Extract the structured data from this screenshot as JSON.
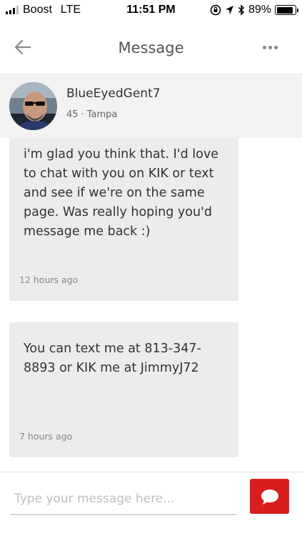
{
  "status_bar": {
    "carrier": "Boost",
    "network": "LTE",
    "time": "11:51 PM",
    "battery_percent": "89%",
    "battery_level": 0.89
  },
  "nav": {
    "title": "Message",
    "back_icon": "arrow-left-icon",
    "more_icon": "more-horizontal-icon"
  },
  "profile": {
    "username": "BlueEyedGent7",
    "age": "45",
    "separator": "·",
    "location": "Tampa"
  },
  "messages": [
    {
      "text": "i'm glad you think that. I'd love to chat with you on KIK or text and see if we're on the same page. Was really hoping you'd message me back :)",
      "time": "12 hours ago"
    },
    {
      "text": "You can text me at 813-347-8893 or KIK me at JimmyJ72",
      "time": "7 hours ago"
    }
  ],
  "composer": {
    "placeholder": "Type your message here...",
    "send_icon": "chat-bubble-icon"
  },
  "colors": {
    "accent": "#d81e1e",
    "bubble_bg": "#ececec",
    "header_bg": "#f2f2f2"
  }
}
